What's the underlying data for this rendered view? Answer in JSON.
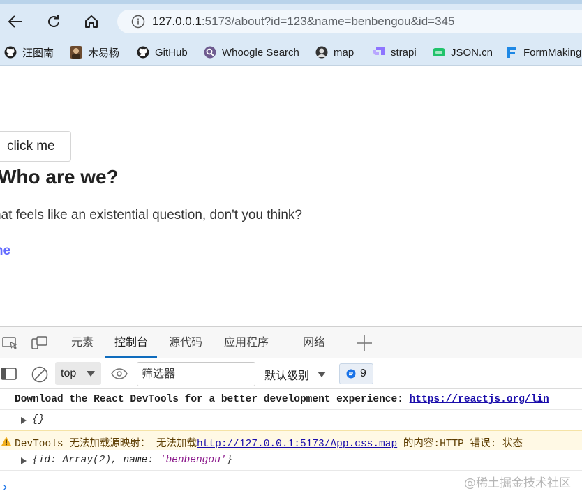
{
  "browser": {
    "url_host": "127.0.0.1",
    "url_rest": ":5173/about?id=123&name=benbengou&id=345",
    "bookmarks": [
      {
        "label": "汪图南",
        "icon": "github-icon"
      },
      {
        "label": "木易杨",
        "icon": "avatar-icon"
      },
      {
        "label": "GitHub",
        "icon": "github-icon"
      },
      {
        "label": "Whoogle Search",
        "icon": "whoogle-icon"
      },
      {
        "label": "map",
        "icon": "avatar-icon"
      },
      {
        "label": "strapi",
        "icon": "strapi-icon"
      },
      {
        "label": "JSON.cn",
        "icon": "json-icon"
      },
      {
        "label": "FormMaking",
        "icon": "formmaking-icon"
      }
    ]
  },
  "page": {
    "button_label": "click me",
    "title": "Who are we?",
    "text": "hat feels like an existential question, don't you think?",
    "link": "ome",
    "link_color": "#646cff"
  },
  "devtools": {
    "tabs": [
      {
        "label": "元素",
        "active": false
      },
      {
        "label": "控制台",
        "active": true
      },
      {
        "label": "源代码",
        "active": false
      },
      {
        "label": "应用程序",
        "active": false
      },
      {
        "label": "网络",
        "active": false
      }
    ],
    "context": "top",
    "filter_placeholder": "筛选器",
    "levels": "默认级别",
    "message_count": "9",
    "console": {
      "line1_text": "Download the React DevTools for a better development experience: ",
      "line1_link": "https://reactjs.org/lin",
      "line2": "{}",
      "warn_prefix": "DevTools 无法加载源映射： 无法加载",
      "warn_link": "http://127.0.0.1:5173/App.css.map",
      "warn_suffix": " 的内容:HTTP 错误: 状态",
      "obj_open": "{",
      "obj_key1": "id",
      "obj_val1": ": Array(2), ",
      "obj_key2": "name",
      "obj_colon2": ": ",
      "obj_val2": "'benbengou'",
      "obj_close": "}"
    },
    "prompt": "›"
  },
  "watermark": "@稀土掘金技术社区",
  "colors": {
    "chrome_bg": "#dbe9f6",
    "accent": "#0f6cbd",
    "link": "#1a0dab",
    "warn_bg": "#fff9e5"
  }
}
